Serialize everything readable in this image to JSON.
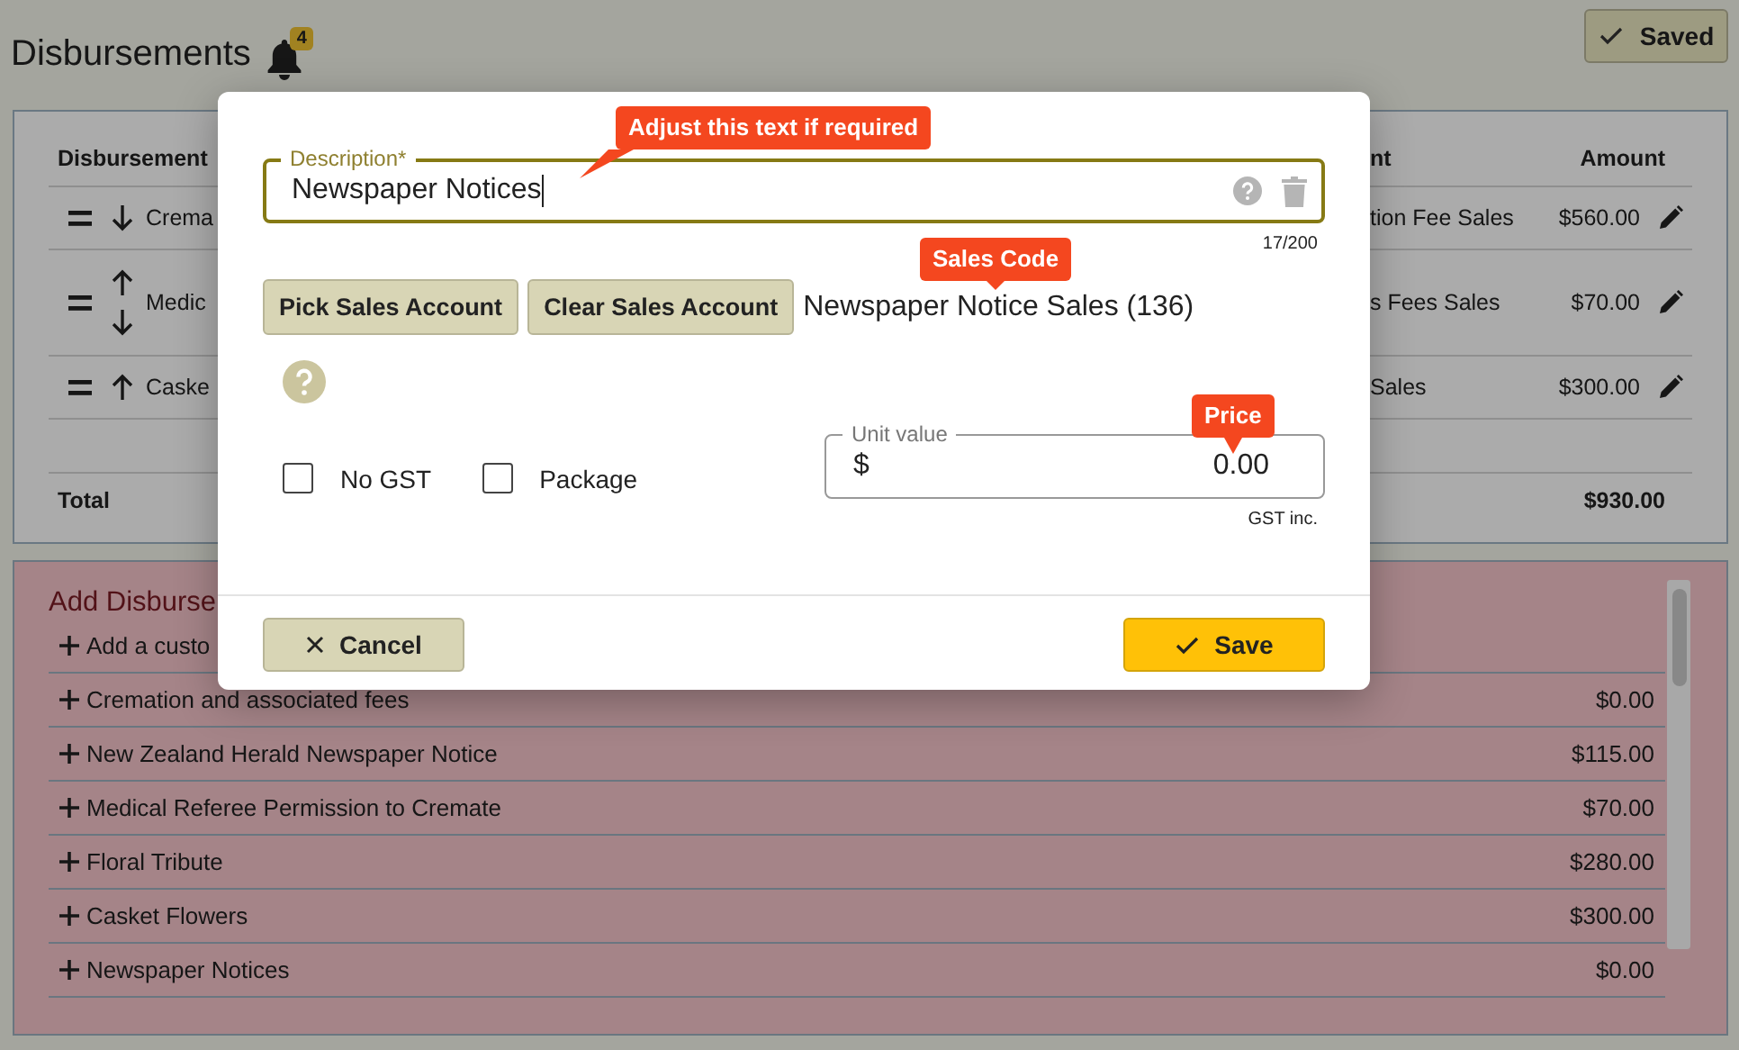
{
  "header": {
    "title": "Disbursements",
    "notification_count": "4",
    "save_status": "Saved"
  },
  "table": {
    "columns": [
      "Disbursement",
      "nt",
      "Amount"
    ],
    "rows": [
      {
        "name": "Crema",
        "can_move_up": false,
        "can_move_down": true,
        "account": "tion Fee Sales",
        "amount": "$560.00"
      },
      {
        "name": "Medic",
        "can_move_up": true,
        "can_move_down": true,
        "account": "s Fees Sales",
        "amount": "$70.00"
      },
      {
        "name": "Caske",
        "can_move_up": true,
        "can_move_down": false,
        "account": "Sales",
        "amount": "$300.00"
      }
    ],
    "total_label": "Total",
    "total": "$930.00"
  },
  "add_panel": {
    "title": "Add Disburse",
    "items": [
      {
        "name": "Add a custo"
      },
      {
        "name": "Cremation and associated fees",
        "amount": "$0.00"
      },
      {
        "name": "New Zealand Herald Newspaper Notice",
        "amount": "$115.00"
      },
      {
        "name": "Medical Referee Permission to Cremate",
        "amount": "$70.00"
      },
      {
        "name": "Floral Tribute",
        "amount": "$280.00"
      },
      {
        "name": "Casket Flowers",
        "amount": "$300.00"
      },
      {
        "name": "Newspaper Notices",
        "amount": "$0.00"
      }
    ]
  },
  "dialog": {
    "description": {
      "label": "Description*",
      "value": "Newspaper Notices",
      "counter": "17/200",
      "callout": "Adjust this text if required"
    },
    "pick_button": "Pick Sales Account",
    "clear_button": "Clear Sales Account",
    "sales_account": "Newspaper Notice Sales (136)",
    "sales_callout": "Sales Code",
    "checkboxes": [
      {
        "label": "No GST",
        "checked": false
      },
      {
        "label": "Package",
        "checked": false
      }
    ],
    "unit_value": {
      "label": "Unit value",
      "prefix": "$",
      "value": "0.00",
      "note": "GST inc.",
      "callout": "Price"
    },
    "cancel_button": "Cancel",
    "save_button": "Save"
  }
}
